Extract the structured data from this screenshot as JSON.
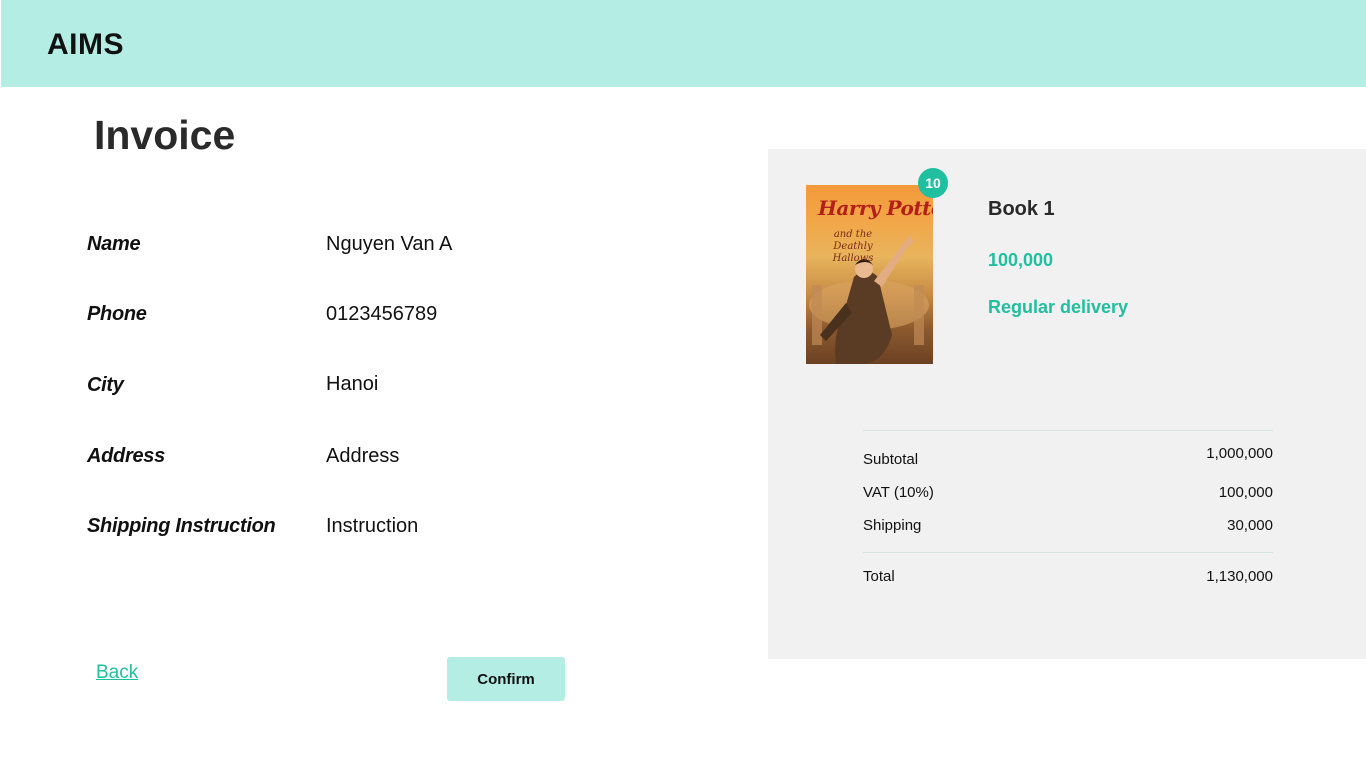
{
  "header": {
    "brand": "AIMS"
  },
  "page": {
    "title": "Invoice"
  },
  "form": {
    "fields": [
      {
        "label": "Name",
        "value": "Nguyen Van A"
      },
      {
        "label": "Phone",
        "value": "0123456789"
      },
      {
        "label": "City",
        "value": "Hanoi"
      },
      {
        "label": "Address",
        "value": "Address"
      },
      {
        "label": "Shipping Instruction",
        "value": "Instruction"
      }
    ]
  },
  "actions": {
    "back_label": "Back",
    "confirm_label": "Confirm"
  },
  "cart": {
    "item": {
      "name": "Book 1",
      "price": "100,000",
      "delivery": "Regular delivery",
      "quantity": "10",
      "cover_title": "Harry Potter",
      "cover_subtitle": "and the Deathly Hallows"
    },
    "summary": {
      "subtotal_label": "Subtotal",
      "subtotal_value": "1,000,000",
      "vat_label": "VAT (10%)",
      "vat_value": "100,000",
      "shipping_label": "Shipping",
      "shipping_value": "30,000",
      "total_label": "Total",
      "total_value": "1,130,000"
    }
  },
  "colors": {
    "header_bg": "#b3ede3",
    "accent": "#1fbf9f",
    "panel_bg": "#f1f1f1"
  }
}
